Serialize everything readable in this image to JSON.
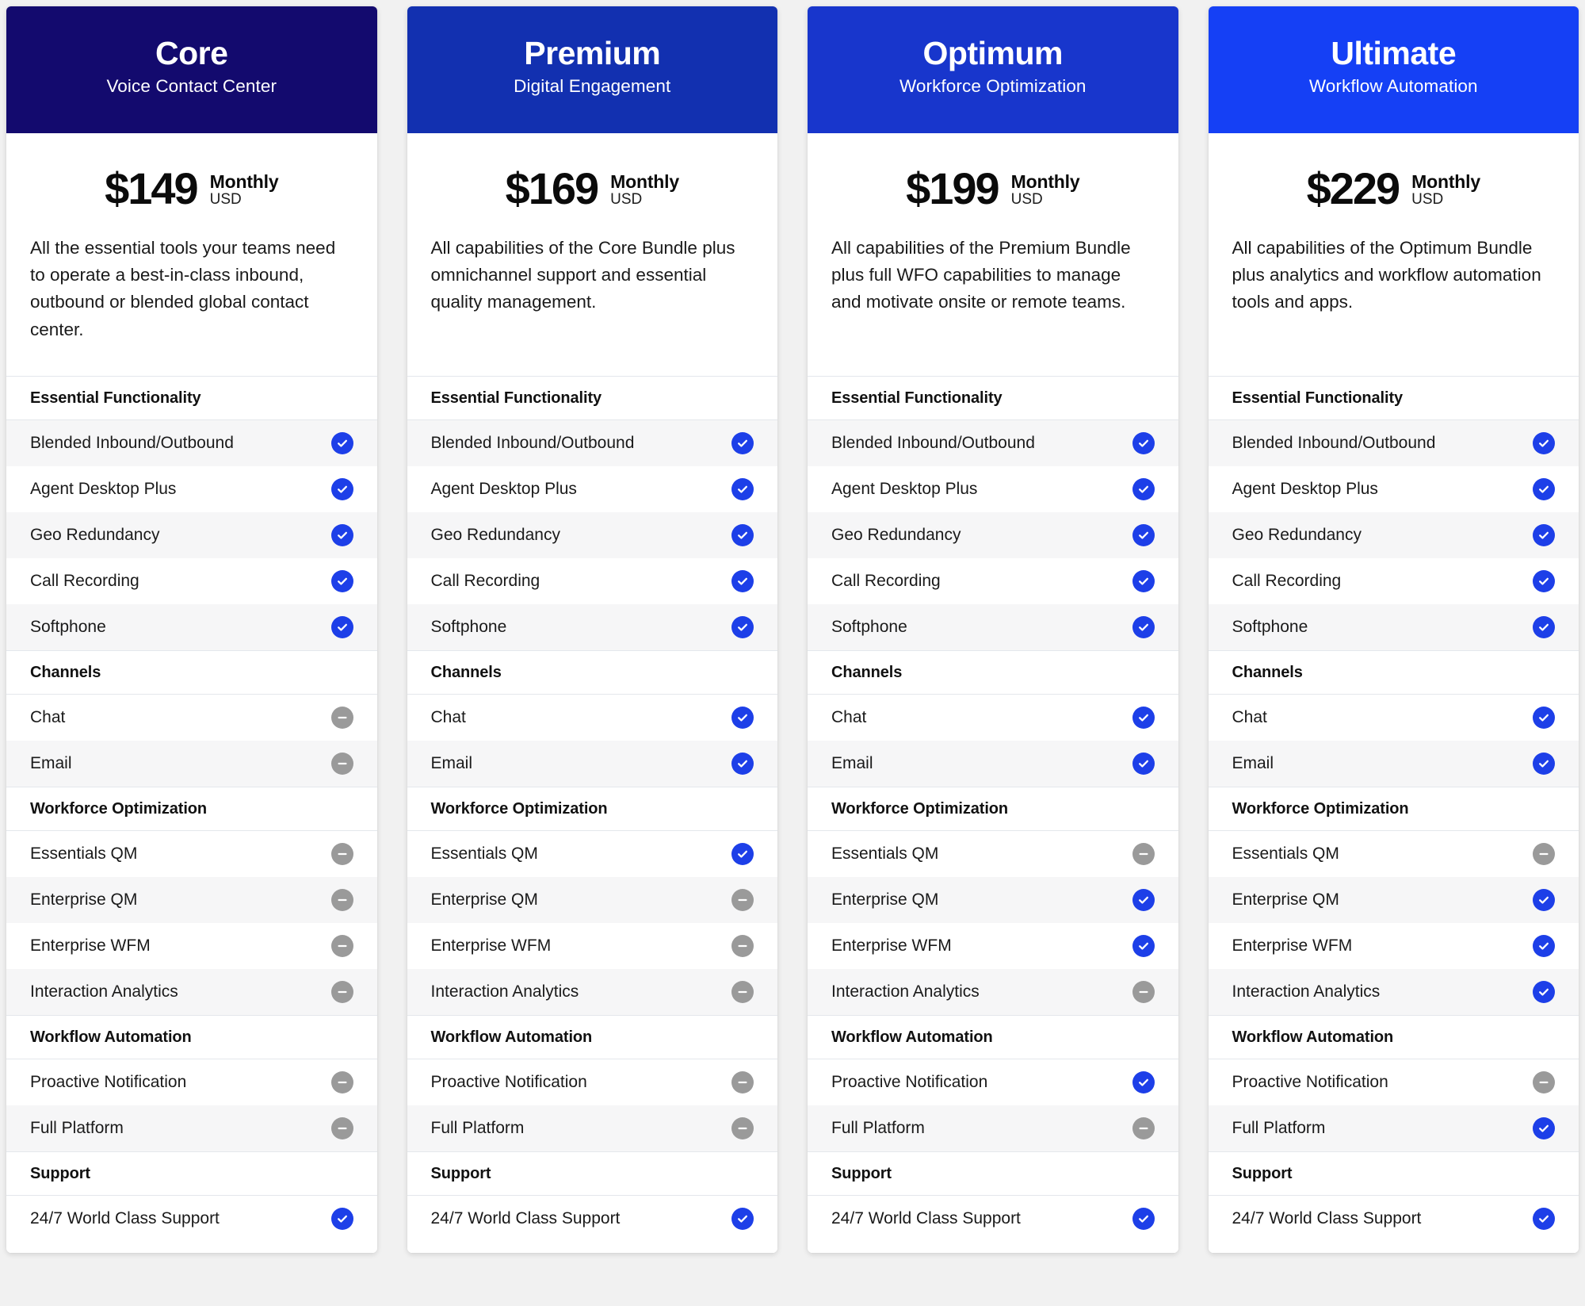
{
  "theme": {
    "page_background": "#f1f1f1",
    "included_color": "#1d3fe8",
    "excluded_color": "#9a9a9a",
    "row_alt_background": "#f6f6f7"
  },
  "icons": {
    "included": "check-circle-icon",
    "excluded": "minus-circle-icon"
  },
  "section_titles": {
    "essential": "Essential Functionality",
    "channels": "Channels",
    "wfo": "Workforce Optimization",
    "workflow": "Workflow Automation",
    "support": "Support"
  },
  "features": {
    "essential": [
      "Blended Inbound/Outbound",
      "Agent Desktop Plus",
      "Geo Redundancy",
      "Call Recording",
      "Softphone"
    ],
    "channels": [
      "Chat",
      "Email"
    ],
    "wfo": [
      "Essentials QM",
      "Enterprise QM",
      "Enterprise WFM",
      "Interaction Analytics"
    ],
    "workflow": [
      "Proactive Notification",
      "Full Platform"
    ],
    "support": [
      "24/7 World Class Support"
    ]
  },
  "plans": [
    {
      "name": "Core",
      "tagline": "Voice Contact Center",
      "header_color": "#130a6e",
      "price": "$149",
      "period": "Monthly",
      "currency": "USD",
      "description": "All the essential tools your teams need to operate a best-in-class inbound, outbound or blended global contact center.",
      "availability": {
        "essential": [
          true,
          true,
          true,
          true,
          true
        ],
        "channels": [
          false,
          false
        ],
        "wfo": [
          false,
          false,
          false,
          false
        ],
        "workflow": [
          false,
          false
        ],
        "support": [
          true
        ]
      }
    },
    {
      "name": "Premium",
      "tagline": "Digital Engagement",
      "header_color": "#1230b0",
      "price": "$169",
      "period": "Monthly",
      "currency": "USD",
      "description": "All capabilities of the Core Bundle plus omnichannel support and essential quality management.",
      "availability": {
        "essential": [
          true,
          true,
          true,
          true,
          true
        ],
        "channels": [
          true,
          true
        ],
        "wfo": [
          true,
          false,
          false,
          false
        ],
        "workflow": [
          false,
          false
        ],
        "support": [
          true
        ]
      }
    },
    {
      "name": "Optimum",
      "tagline": "Workforce Optimization",
      "header_color": "#1836cc",
      "price": "$199",
      "period": "Monthly",
      "currency": "USD",
      "description": "All capabilities of the Premium Bundle plus full WFO capabilities to manage and motivate onsite or remote teams.",
      "availability": {
        "essential": [
          true,
          true,
          true,
          true,
          true
        ],
        "channels": [
          true,
          true
        ],
        "wfo": [
          false,
          true,
          true,
          false
        ],
        "workflow": [
          true,
          false
        ],
        "support": [
          true
        ]
      }
    },
    {
      "name": "Ultimate",
      "tagline": "Workflow Automation",
      "header_color": "#1540f5",
      "price": "$229",
      "period": "Monthly",
      "currency": "USD",
      "description": "All capabilities of the Optimum Bundle plus analytics and workflow automation tools and apps.",
      "availability": {
        "essential": [
          true,
          true,
          true,
          true,
          true
        ],
        "channels": [
          true,
          true
        ],
        "wfo": [
          false,
          true,
          true,
          true
        ],
        "workflow": [
          false,
          true
        ],
        "support": [
          true
        ]
      }
    }
  ]
}
